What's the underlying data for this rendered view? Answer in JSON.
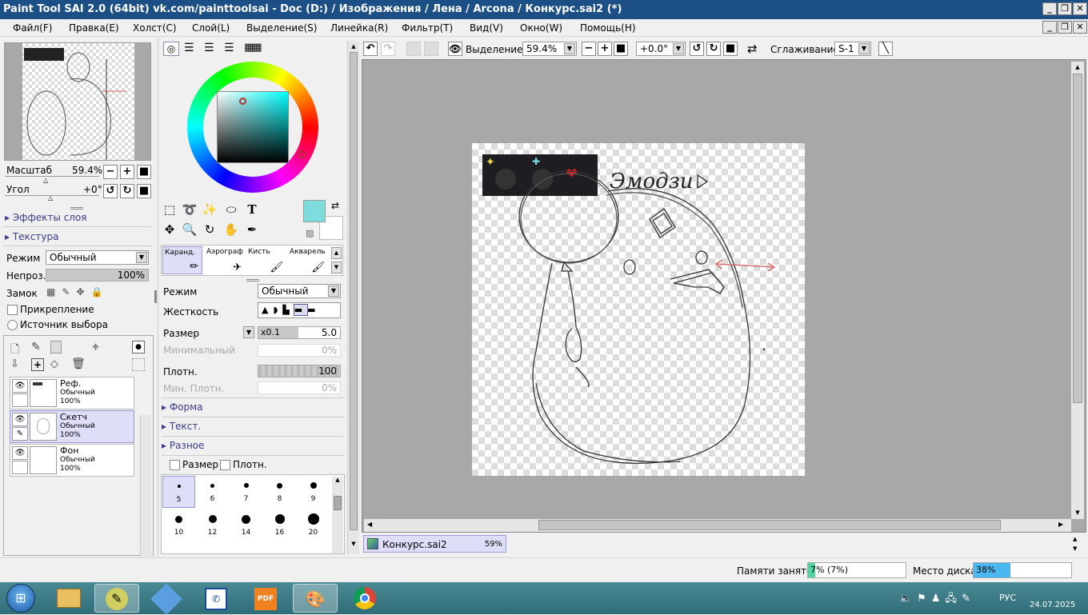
{
  "window": {
    "title": "Paint Tool SAI 2.0 (64bit) vk.com/painttoolsai - Doc (D:) / Изображения / Лена / Arcona / Конкурс.sai2 (*)"
  },
  "menu": [
    "Файл(F)",
    "Правка(E)",
    "Холст(C)",
    "Слой(L)",
    "Выделение(S)",
    "Линейка(R)",
    "Фильтр(T)",
    "Вид(V)",
    "Окно(W)",
    "Помощь(H)"
  ],
  "navigator": {
    "zoom_label": "Масштаб",
    "zoom_value": "59.4%",
    "angle_label": "Угол",
    "angle_value": "+0°"
  },
  "layer_panel": {
    "effects": "Эффекты слоя",
    "texture": "Текстура",
    "mode_label": "Режим",
    "mode_value": "Обычный",
    "opacity_label": "Непроз.",
    "opacity_value": "100%",
    "lock_label": "Замок",
    "clip_label": "Прикрепление",
    "source_label": "Источник выбора",
    "layers": [
      {
        "name": "Реф.",
        "mode": "Обычный",
        "opacity": "100%"
      },
      {
        "name": "Скетч",
        "mode": "Обычный",
        "opacity": "100%"
      },
      {
        "name": "Фон",
        "mode": "Обычный",
        "opacity": "100%"
      }
    ]
  },
  "tool_panel": {
    "tools": [
      "Каранд.",
      "Аэрограф",
      "Кисть",
      "Акварель"
    ],
    "mode_label": "Режим",
    "mode_value": "Обычный",
    "hardness_label": "Жесткость",
    "size_label": "Размер",
    "size_mult": "x0.1",
    "size_value": "5.0",
    "min_size_label": "Минимальный",
    "min_size_value": "0%",
    "density_label": "Плотн.",
    "density_value": "100",
    "min_density_label": "Мин. Плотн.",
    "min_density_value": "0%",
    "shape": "Форма",
    "texture": "Текст.",
    "misc": "Разное",
    "size_check": "Размер",
    "density_check": "Плотн.",
    "brush_sizes": [
      "5",
      "6",
      "7",
      "8",
      "9",
      "10",
      "12",
      "14",
      "16",
      "20"
    ]
  },
  "canvas_toolbar": {
    "selection_label": "Выделение",
    "zoom": "59.4%",
    "angle": "+0.0°",
    "smoothing_label": "Сглаживание",
    "smoothing_value": "S-1"
  },
  "doc_tab": {
    "name": "Конкурс.sai2",
    "zoom": "59%"
  },
  "canvas_text": {
    "handwriting": "Эмодзи"
  },
  "status": {
    "memory_label": "Памяти занято",
    "memory_value": "7% (7%)",
    "memory_pct": 7,
    "disk_label": "Место диска",
    "disk_value": "38%",
    "disk_pct": 38
  },
  "taskbar": {
    "lang": "РУС",
    "date": "24.07.2025"
  },
  "colors": {
    "current": "#7fdcdc",
    "title": "#1b4f86",
    "taskbar": "#3a7c87"
  }
}
